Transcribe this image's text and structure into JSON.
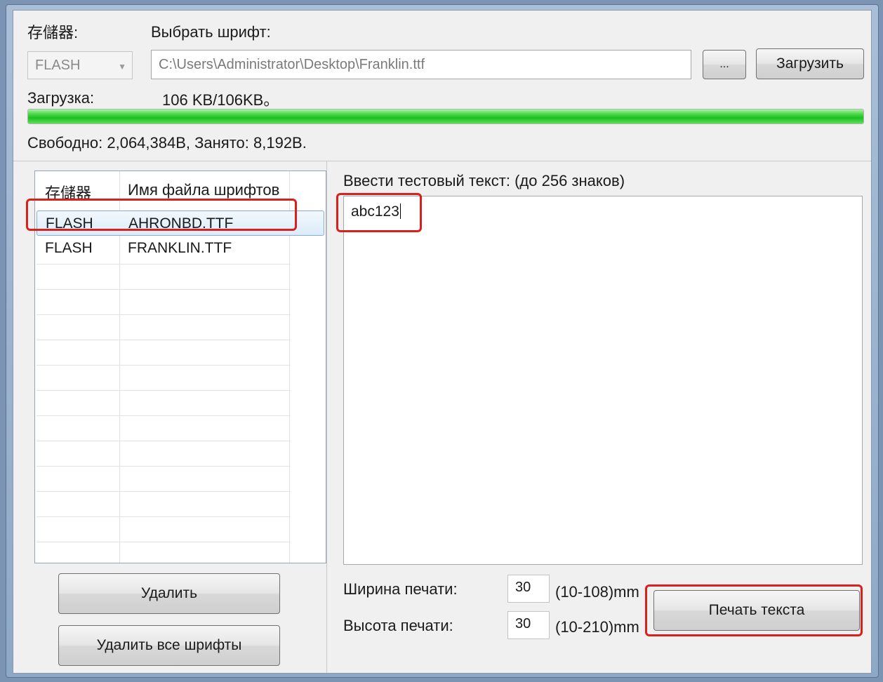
{
  "storage_label": "存儲器:",
  "font_select_label": "Выбрать шрифт:",
  "storage_value": "FLASH",
  "path_value": "C:\\Users\\Administrator\\Desktop\\Franklin.ttf",
  "browse_label": "...",
  "upload_label": "Загрузить",
  "download_label": "Загрузка:",
  "download_value": "106 KB/106KB。",
  "progress_fraction": 1.0,
  "memory_text": "Свободно: 2,064,384B, Занято: 8,192B.",
  "table": {
    "col_storage": "存儲器",
    "col_filename": "Имя файла шрифтов",
    "rows": [
      {
        "storage": "FLASH",
        "file": "AHRONBD.TTF"
      },
      {
        "storage": "FLASH",
        "file": "FRANKLIN.TTF"
      }
    ]
  },
  "delete_label": "Удалить",
  "delete_all_label": "Удалить все шрифты",
  "test_text_label": "Ввести тестовый текст: (до 256 знаков)",
  "test_text_value": "abc123",
  "width_label": "Ширина печати:",
  "width_value": "30",
  "width_range": "(10-108)mm",
  "height_label": "Высота печати:",
  "height_value": "30",
  "height_range": "(10-210)mm",
  "print_label": "Печать текста",
  "colors": {
    "highlight": "#d9201c",
    "progress": "#22c226"
  }
}
